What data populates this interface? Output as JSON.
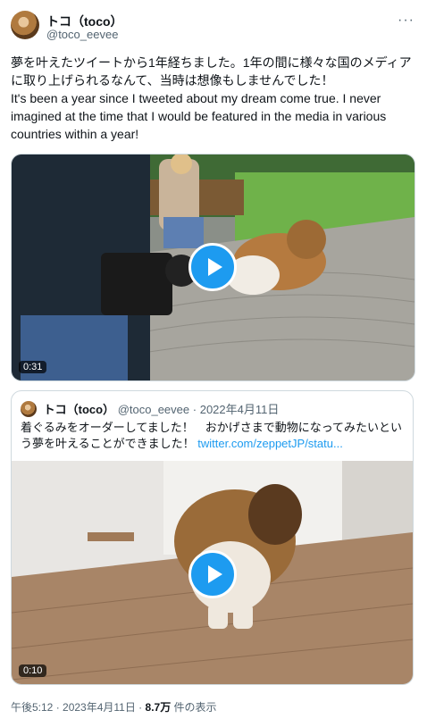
{
  "author": {
    "name": "トコ（toco）",
    "handle": "@toco_eevee"
  },
  "menu_icon": "more-icon",
  "tweet": {
    "text_ja": "夢を叶えたツイートから1年経ちました。1年の間に様々な国のメディアに取り上げられるなんて、当時は想像もしませんでした！",
    "text_en": "It's been a year since I tweeted about my dream come true. I never imagined at the time that I would be featured in the media in various countries within a year!"
  },
  "video1": {
    "duration": "0:31",
    "icon": "play-icon"
  },
  "quote": {
    "name": "トコ（toco）",
    "handle": "@toco_eevee",
    "sep": "·",
    "date": "2022年4月11日",
    "text": "着ぐるみをオーダーしてました！　おかげさまで動物になってみたいという夢を叶えることができました！",
    "link": "twitter.com/zeppetJP/statu...",
    "video": {
      "duration": "0:10",
      "icon": "play-icon"
    }
  },
  "footer": {
    "time": "午後5:12 · 2023年4月11日 · ",
    "views": "8.7万",
    "views_label": " 件の表示"
  },
  "colors": {
    "accent": "#1d9bf0",
    "text": "#0f1419",
    "muted": "#536471",
    "border": "#cfd9de"
  }
}
